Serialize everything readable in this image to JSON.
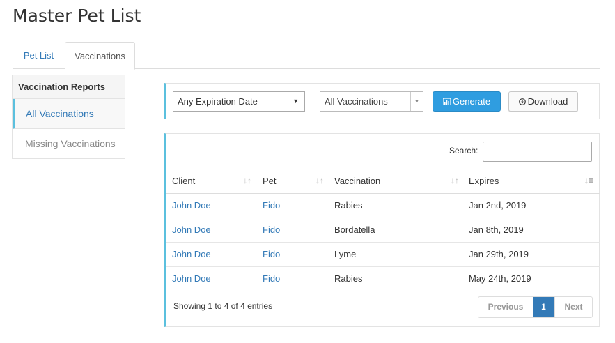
{
  "page": {
    "title": "Master Pet List"
  },
  "tabs": [
    {
      "label": "Pet List",
      "active": false
    },
    {
      "label": "Vaccinations",
      "active": true
    }
  ],
  "sidebar": {
    "header": "Vaccination Reports",
    "items": [
      {
        "label": "All Vaccinations",
        "active": true
      },
      {
        "label": "Missing Vaccinations",
        "active": false
      }
    ]
  },
  "filters": {
    "expiration_select": "Any Expiration Date",
    "vaccination_select": "All Vaccinations",
    "generate_label": "Generate",
    "download_label": "Download"
  },
  "table": {
    "search_label": "Search:",
    "search_value": "",
    "columns": [
      "Client",
      "Pet",
      "Vaccination",
      "Expires"
    ],
    "rows": [
      {
        "client": "John Doe",
        "pet": "Fido",
        "vaccination": "Rabies",
        "expires": "Jan 2nd, 2019"
      },
      {
        "client": "John Doe",
        "pet": "Fido",
        "vaccination": "Bordatella",
        "expires": "Jan 8th, 2019"
      },
      {
        "client": "John Doe",
        "pet": "Fido",
        "vaccination": "Lyme",
        "expires": "Jan 29th, 2019"
      },
      {
        "client": "John Doe",
        "pet": "Fido",
        "vaccination": "Rabies",
        "expires": "May 24th, 2019"
      }
    ],
    "info": "Showing 1 to 4 of 4 entries",
    "pagination": {
      "previous": "Previous",
      "current": "1",
      "next": "Next"
    }
  },
  "colors": {
    "accent": "#5bc0de",
    "link": "#337ab7",
    "primary_button": "#2f9de0"
  }
}
